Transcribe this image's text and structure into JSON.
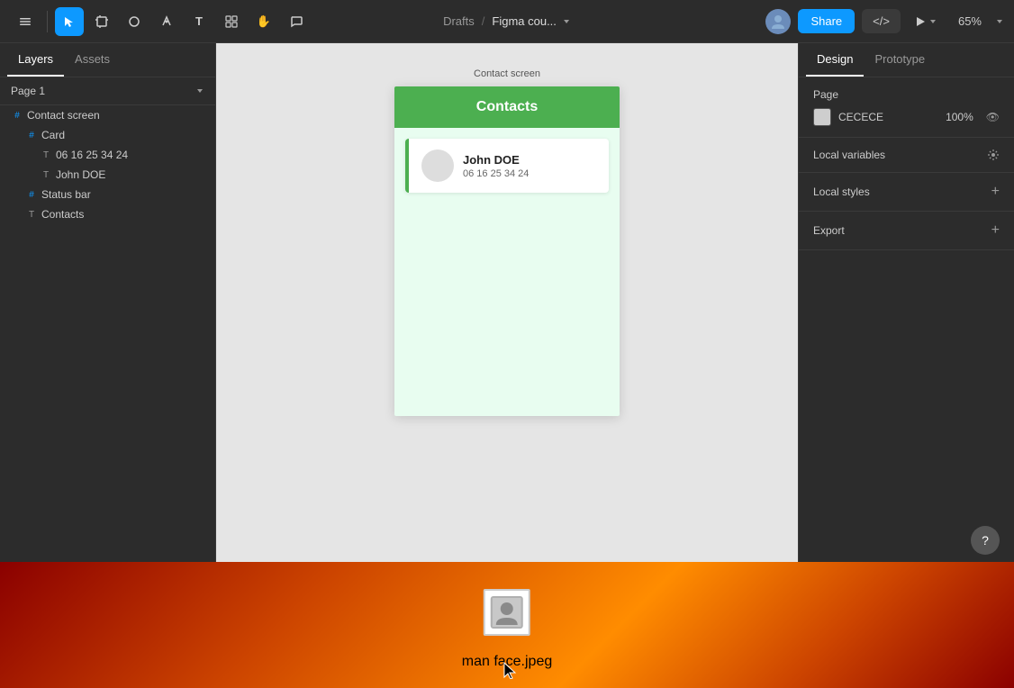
{
  "toolbar": {
    "title": "Figma cou...",
    "breadcrumb_sep": "/",
    "breadcrumb_parent": "Drafts",
    "zoom": "65%",
    "share_label": "Share",
    "code_label": "</>",
    "play_label": "▶",
    "tools": [
      {
        "name": "main-menu",
        "icon": "☰"
      },
      {
        "name": "move",
        "icon": "↖"
      },
      {
        "name": "frame",
        "icon": "#"
      },
      {
        "name": "shapes",
        "icon": "○"
      },
      {
        "name": "pen",
        "icon": "✏"
      },
      {
        "name": "text",
        "icon": "T"
      },
      {
        "name": "components",
        "icon": "⊞"
      },
      {
        "name": "hand",
        "icon": "✋"
      },
      {
        "name": "comment",
        "icon": "💬"
      }
    ]
  },
  "sidebar": {
    "tabs": [
      {
        "label": "Layers",
        "active": true
      },
      {
        "label": "Assets",
        "active": false
      }
    ],
    "page": "Page 1",
    "layers": [
      {
        "id": "contact-screen",
        "label": "Contact screen",
        "icon": "#",
        "indent": 0,
        "type": "frame"
      },
      {
        "id": "card",
        "label": "Card",
        "icon": "#",
        "indent": 1,
        "type": "frame"
      },
      {
        "id": "phone-number",
        "label": "06 16 25 34 24",
        "icon": "T",
        "indent": 2,
        "type": "text"
      },
      {
        "id": "john-doe",
        "label": "John DOE",
        "icon": "T",
        "indent": 2,
        "type": "text"
      },
      {
        "id": "status-bar",
        "label": "Status bar",
        "icon": "#",
        "indent": 1,
        "type": "frame"
      },
      {
        "id": "contacts-text",
        "label": "Contacts",
        "icon": "T",
        "indent": 1,
        "type": "text"
      }
    ]
  },
  "canvas": {
    "label": "Contact screen",
    "phone": {
      "header_text": "Contacts",
      "header_bg": "#4caf50",
      "contact": {
        "name": "John DOE",
        "phone": "06 16 25 34 24"
      }
    }
  },
  "right_panel": {
    "tabs": [
      {
        "label": "Design",
        "active": true
      },
      {
        "label": "Prototype",
        "active": false
      }
    ],
    "sections": {
      "page": {
        "title": "Page",
        "color": "CECECE",
        "opacity": "100%"
      },
      "local_variables": {
        "title": "Local variables"
      },
      "local_styles": {
        "title": "Local styles"
      },
      "export": {
        "title": "Export"
      }
    }
  },
  "taskbar": {
    "dragging_label": "man face.jpeg",
    "thumbnail_alt": "man face photo"
  }
}
